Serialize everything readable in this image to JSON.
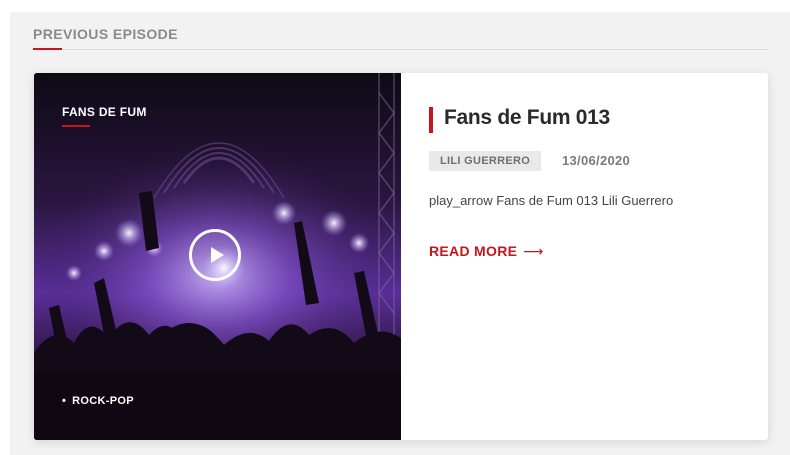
{
  "section": {
    "title": "PREVIOUS EPISODE"
  },
  "episode": {
    "show_label": "FANS DE FUM",
    "genre": "ROCK-POP",
    "genre_bullet": "•",
    "title": "Fans de Fum 013",
    "author": "LILI GUERRERO",
    "date": "13/06/2020",
    "excerpt": "play_arrow Fans de Fum 013 Lili Guerrero",
    "read_more": "READ MORE",
    "read_more_arrow": "⟶"
  },
  "icons": {
    "play": "play-circle-icon",
    "arrow": "long-arrow-right-icon"
  },
  "colors": {
    "accent": "#c4161c",
    "panel": "#f2f2f2",
    "title": "#2a2a2a",
    "badge_bg": "#e9e9e9"
  }
}
